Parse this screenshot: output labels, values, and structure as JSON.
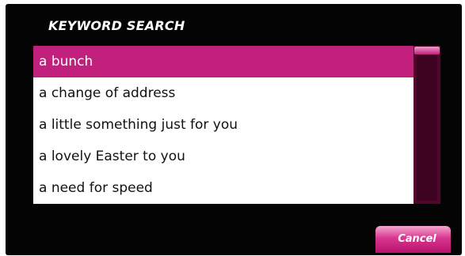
{
  "header": {
    "title": "KEYWORD SEARCH"
  },
  "list": {
    "selected_index": 0,
    "items": [
      {
        "label": "a bunch"
      },
      {
        "label": "a change of address"
      },
      {
        "label": "a little something just for you"
      },
      {
        "label": "a lovely Easter to you"
      },
      {
        "label": "a need for speed"
      }
    ]
  },
  "footer": {
    "cancel_label": "Cancel"
  },
  "colors": {
    "background": "#040404",
    "accent": "#c2207d",
    "scrollbar": "#54052c",
    "list_background": "#ffffff"
  }
}
